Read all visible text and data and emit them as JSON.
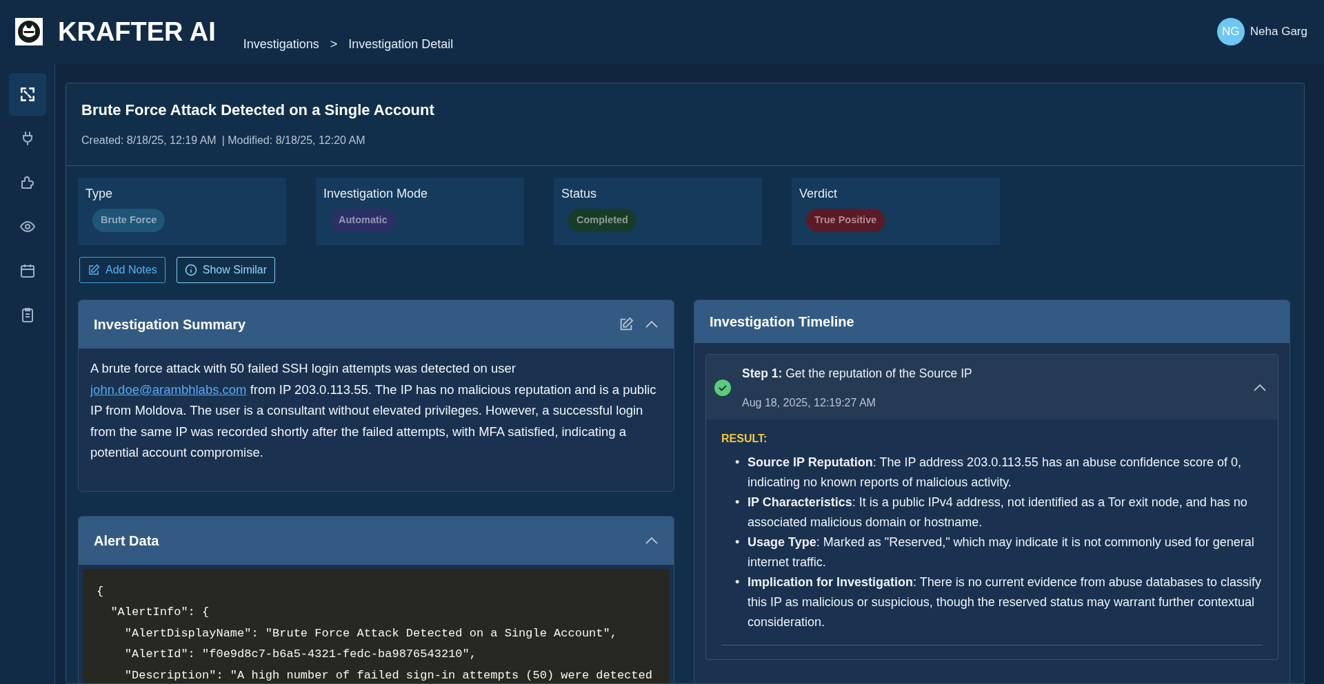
{
  "app": {
    "name": "KRAFTER AI"
  },
  "breadcrumb": [
    {
      "label": "Investigations"
    },
    {
      "label": ">"
    },
    {
      "label": "Investigation Detail"
    }
  ],
  "user": {
    "initials": "NG",
    "name": "Neha Garg"
  },
  "sidebar": {
    "items": [
      {
        "selected": true
      },
      {
        "selected": false
      },
      {
        "selected": false
      },
      {
        "selected": false
      },
      {
        "selected": false
      },
      {
        "selected": false
      }
    ]
  },
  "investigation": {
    "title": "Brute Force Attack Detected on a Single Account",
    "created": "Created: 8/18/25, 12:19 AM",
    "modified": "| Modified: 8/18/25, 12:20 AM"
  },
  "fields": [
    {
      "label": "Type",
      "value": "Brute Force",
      "color": "#1f5577"
    },
    {
      "label": "Investigation Mode",
      "value": "Automatic",
      "color": "#2a2f66"
    },
    {
      "label": "Status",
      "value": "Completed",
      "color": "#183c2a"
    },
    {
      "label": "Verdict",
      "value": "True Positive",
      "color": "#5a1a26"
    }
  ],
  "actions": [
    {
      "label": "Add Notes",
      "kind": "notes"
    },
    {
      "label": "Show Similar",
      "kind": "info"
    }
  ],
  "summary": {
    "title": "Investigation Summary",
    "expanded": true,
    "text_before": "A brute force attack with 50 failed SSH login attempts was detected on user",
    "link": "john.doe@arambhlabs.com",
    "text_after": "from IP 203.0.113.55. The IP has no malicious reputation and is a public IP from Moldova. The user is a consultant without elevated privileges. However, a successful login from the same IP was recorded shortly after the failed attempts, with MFA satisfied, indicating a potential account compromise."
  },
  "alert_data": {
    "title": "Alert Data",
    "expanded": true,
    "lines": [
      "{",
      "  \"AlertInfo\": {",
      "    \"AlertDisplayName\": \"Brute Force Attack Detected on a Single Account\",",
      "    \"AlertId\": \"f0e9d8c7-b6a5-4321-fedc-ba9876543210\",",
      "    \"Description\": \"A high number of failed sign-in attempts (50) were detected"
    ]
  },
  "timeline": {
    "title": "Investigation Timeline",
    "steps": [
      {
        "label": "Step 1:",
        "text": "Get the reputation of the Source IP",
        "time": "Aug 18, 2025, 12:19:27 AM",
        "completed": true,
        "expanded": true,
        "result_label": "RESULT:",
        "bullet": "•",
        "results": [
          "**Source IP Reputation**: The IP address 203.0.113.55 has an abuse confidence score of 0, indicating no known reports of malicious activity.",
          "**IP Characteristics**: It is a public IPv4 address, not identified as a Tor exit node, and has no associated malicious domain or hostname.",
          "**Usage Type**: Marked as \"Reserved,\" which may indicate it is not commonly used for general internet traffic.",
          "**Implication for Investigation**: There is no current evidence from abuse databases to classify this IP as malicious or suspicious, though the reserved status may warrant further contextual consideration."
        ]
      }
    ]
  }
}
